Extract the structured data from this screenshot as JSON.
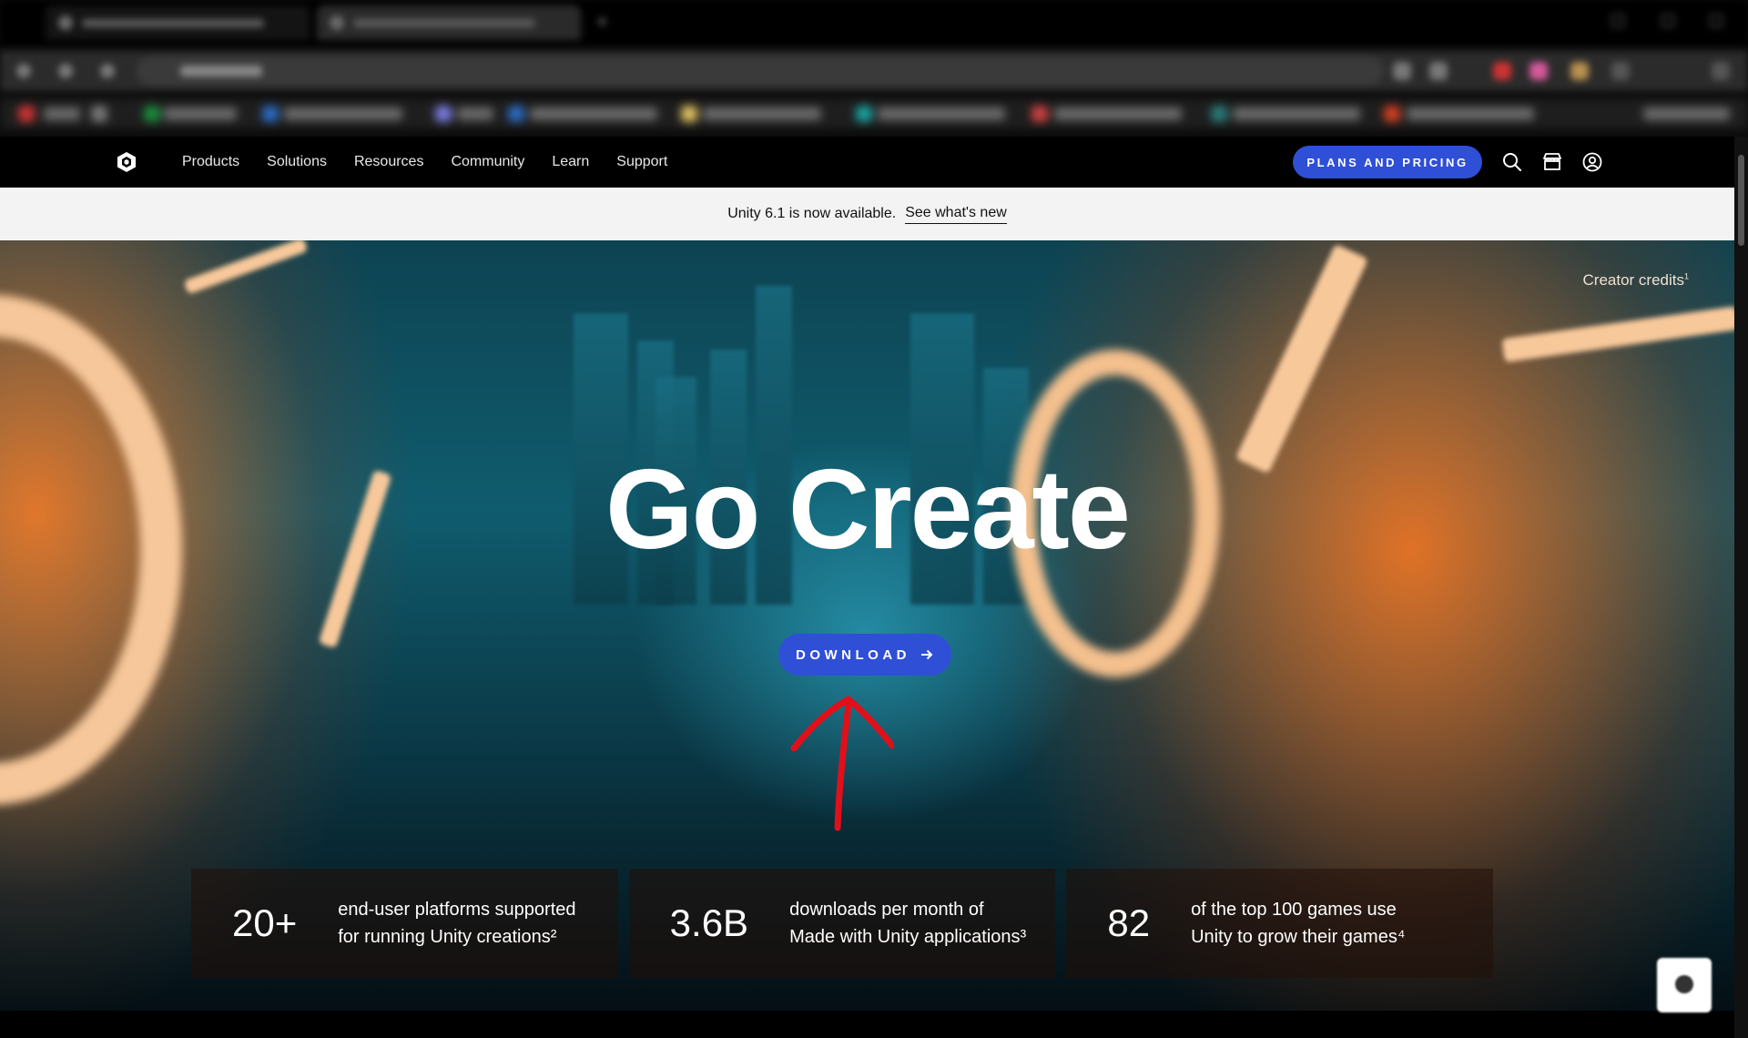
{
  "site_nav": {
    "logo": "unity-logo-icon",
    "links": [
      "Products",
      "Solutions",
      "Resources",
      "Community",
      "Learn",
      "Support"
    ],
    "plans_label": "PLANS AND PRICING",
    "icons": [
      "search-icon",
      "store-icon",
      "account-icon"
    ]
  },
  "announce": {
    "text": "Unity 6.1 is now available.",
    "link_label": "See what's new"
  },
  "hero": {
    "title": "Go Create",
    "download_label": "DOWNLOAD",
    "download_icon": "arrow-right-icon",
    "credits_label": "Creator credits",
    "credits_note": "1"
  },
  "stats": [
    {
      "value": "20+",
      "line1": "end-user platforms supported",
      "line2": "for running Unity creations²"
    },
    {
      "value": "3.6B",
      "line1": "downloads per month of",
      "line2": "Made with Unity applications³"
    },
    {
      "value": "82",
      "line1": "of the top 100 games use",
      "line2": "Unity to grow their games⁴"
    }
  ],
  "colors": {
    "accent": "#2f4fd6",
    "nav_bg": "#000000",
    "announce_bg": "#f3f3f3",
    "annotation_arrow": "#e0101a"
  }
}
